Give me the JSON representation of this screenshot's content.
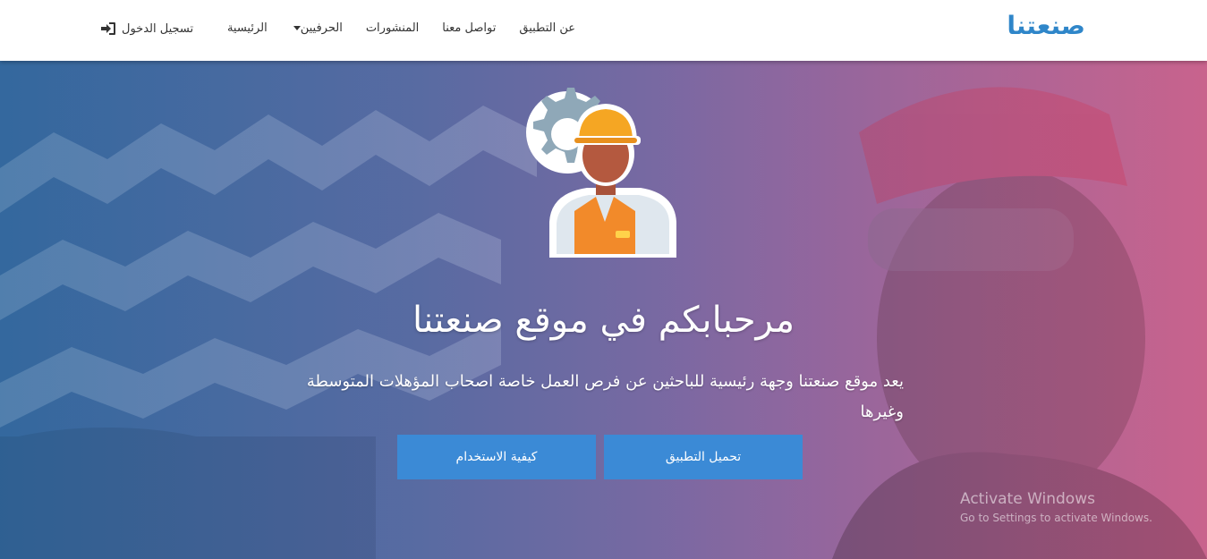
{
  "brand": {
    "name": "صنعتنا"
  },
  "nav": {
    "items": [
      {
        "label": "الرئيسية"
      },
      {
        "label": "الحرفيين",
        "has_dropdown": true
      },
      {
        "label": "المنشورات"
      },
      {
        "label": "تواصل معنا"
      },
      {
        "label": "عن التطبيق"
      }
    ],
    "login_label": "تسجيل الدخول",
    "login_icon": "sign-in-icon"
  },
  "hero": {
    "title": "مرحبابكم في موقع صنعتنا",
    "subtitle": "يعد موقع صنعتنا وجهة رئيسية للباحثين عن فرص العمل خاصة اصحاب المؤهلات المتوسطة وغيرها",
    "icon": "worker-gear-icon",
    "buttons": {
      "download_label": "تحميل التطبيق",
      "howto_label": "كيفية الاستخدام"
    }
  },
  "watermark": {
    "title": "Activate Windows",
    "subtitle": "Go to Settings to activate Windows."
  },
  "colors": {
    "brand": "#2f86c9",
    "button": "#3b8ad6",
    "hero_left": "#3d6c9c",
    "hero_right": "#b86a8e"
  }
}
